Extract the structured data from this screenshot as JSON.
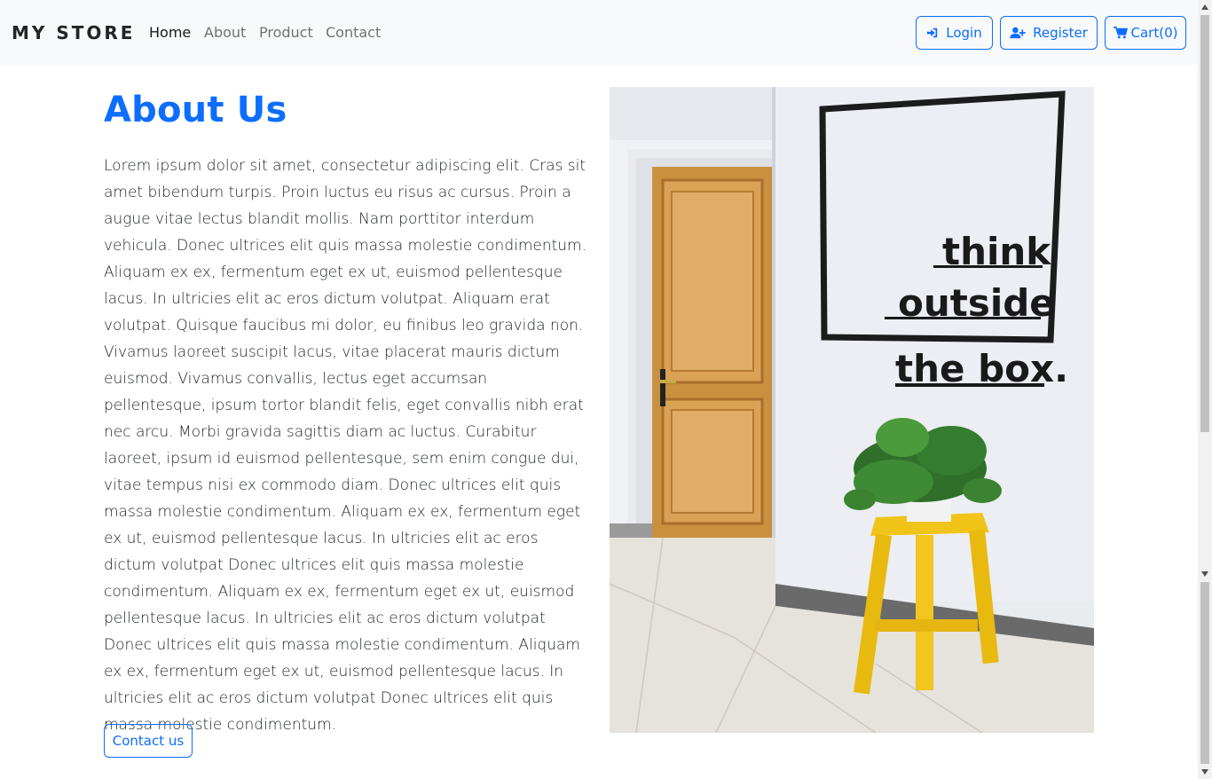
{
  "navbar": {
    "brand": "MY STORE",
    "links": [
      {
        "label": "Home",
        "active": true
      },
      {
        "label": "About",
        "active": false
      },
      {
        "label": "Product",
        "active": false
      },
      {
        "label": "Contact",
        "active": false
      }
    ],
    "buttons": {
      "login": {
        "label": "Login",
        "icon": "sign-in-icon"
      },
      "register": {
        "label": "Register",
        "icon": "user-plus-icon"
      },
      "cart": {
        "label": "Cart(0)",
        "icon": "shopping-cart-icon"
      }
    }
  },
  "about": {
    "title": "About Us",
    "body": "Lorem ipsum dolor sit amet, consectetur adipiscing elit. Cras sit amet bibendum turpis. Proin luctus eu risus ac cursus. Proin a augue vitae lectus blandit mollis. Nam porttitor interdum vehicula. Donec ultrices elit quis massa molestie condimentum. Aliquam ex ex, fermentum eget ex ut, euismod pellentesque lacus. In ultricies elit ac eros dictum volutpat. Aliquam erat volutpat. Quisque faucibus mi dolor, eu finibus leo gravida non. Vivamus laoreet suscipit lacus, vitae placerat mauris dictum euismod. Vivamus convallis, lectus eget accumsan pellentesque, ipsum tortor blandit felis, eget convallis nibh erat nec arcu. Morbi gravida sagittis diam ac luctus. Curabitur laoreet, ipsum id euismod pellentesque, sem enim congue dui, vitae tempus nisi ex commodo diam. Donec ultrices elit quis massa molestie condimentum. Aliquam ex ex, fermentum eget ex ut, euismod pellentesque lacus. In ultricies elit ac eros dictum volutpat Donec ultrices elit quis massa molestie condimentum. Aliquam ex ex, fermentum eget ex ut, euismod pellentesque lacus. In ultricies elit ac eros dictum volutpat Donec ultrices elit quis massa molestie condimentum. Aliquam ex ex, fermentum eget ex ut, euismod pellentesque lacus. In ultricies elit ac eros dictum volutpat Donec ultrices elit quis massa molestie condimentum.",
    "contact_button": "Contact us",
    "image": {
      "wall_text": [
        "think",
        "outside",
        "the box."
      ]
    }
  },
  "colors": {
    "accent": "#0d6efd",
    "navbar_bg": "#f8f9fa",
    "text": "#212529"
  }
}
